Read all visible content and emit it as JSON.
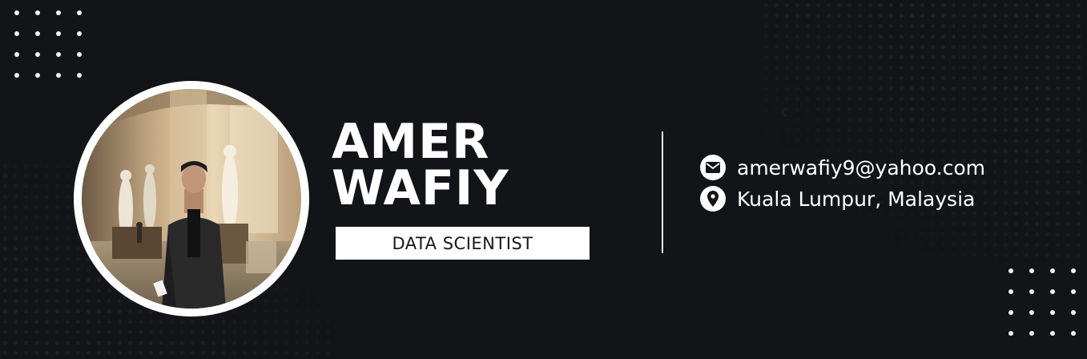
{
  "profile": {
    "name_line1": "AMER",
    "name_line2": "WAFIY",
    "role": "DATA SCIENTIST",
    "photo_icon": "portrait-photo"
  },
  "contact": {
    "email": "amerwafiy9@yahoo.com",
    "email_icon": "email-icon",
    "location": "Kuala Lumpur, Malaysia",
    "location_icon": "location-pin-icon"
  },
  "theme": {
    "background": "#131418",
    "accent": "#ffffff"
  }
}
